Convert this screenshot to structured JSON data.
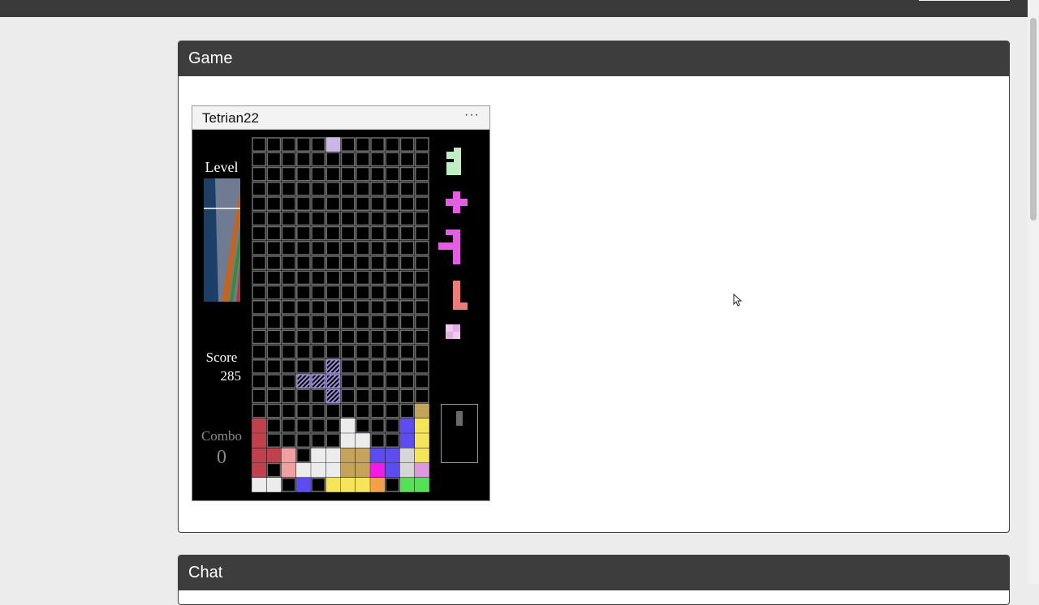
{
  "panels": {
    "game_title": "Game",
    "chat_title": "Chat"
  },
  "game": {
    "window_title": "Tetrian22",
    "menu_label": "···",
    "level_label": "Level",
    "score_label": "Score",
    "score_value": "285",
    "combo_label": "Combo",
    "combo_value": "0",
    "colors": {
      "background": "#000000",
      "grid_line": "#6e6e6e",
      "R": "#c0414d",
      "P": "#f0a0a0",
      "W": "#ececec",
      "G": "#c4a35a",
      "B": "#5d4cf0",
      "Y": "#f6e45a",
      "M": "#f01ce6",
      "O": "#f3a04a",
      "L": "#55e055",
      "K": "#d6d6d6",
      "V": "#de98de",
      "active": "#cbb7e3",
      "ghost": "#9b8fd6",
      "preview_1": "#bfeec6",
      "preview_2": "#e35ee3",
      "preview_3": "#e35ee3",
      "preview_4": "#ee7b7b",
      "preview_5": "#f2c8f0",
      "level_meter": [
        "#1c3f68",
        "#6f7b92",
        "#c5641c",
        "#3e8a2e",
        "#b03a3a"
      ]
    },
    "board": {
      "cols": 12,
      "rows": 24,
      "active_cells": [
        [
          5,
          0
        ]
      ],
      "ghost_cells": [
        [
          3,
          16
        ],
        [
          4,
          16
        ],
        [
          5,
          15
        ],
        [
          5,
          16
        ],
        [
          5,
          17
        ]
      ],
      "rows_bottom": [
        "................",
        "...........GG...",
        "R.....W...BYGG..",
        "R.....WW..BYYG..",
        "RRP.WWGGBBKYYV..",
        "R.PWWWGGMBKVVV..",
        "WW.B.YYYO.LLL..."
      ]
    },
    "preview_pieces": [
      {
        "name": "piece-1",
        "color_key": "preview_1"
      },
      {
        "name": "piece-2",
        "color_key": "preview_2"
      },
      {
        "name": "piece-3",
        "color_key": "preview_3"
      },
      {
        "name": "piece-4",
        "color_key": "preview_4"
      },
      {
        "name": "piece-5",
        "color_key": "preview_5"
      }
    ]
  }
}
